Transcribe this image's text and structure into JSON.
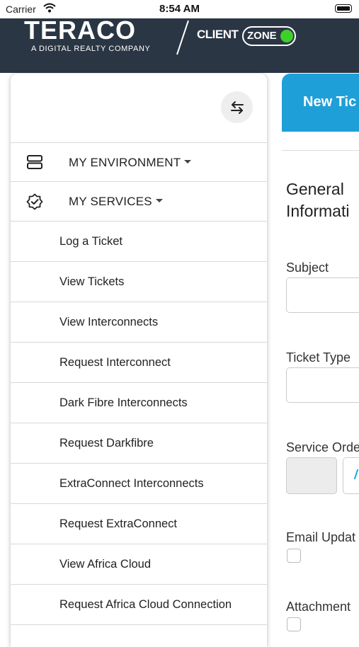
{
  "status_bar": {
    "carrier": "Carrier",
    "time": "8:54 AM"
  },
  "header": {
    "logo": "TERACO",
    "tagline": "A DIGITAL REALTY COMPANY",
    "client_label": "CLIENT",
    "zone_label": "ZONE"
  },
  "colors": {
    "header_bg": "#2b3644",
    "accent_blue": "#1f9fd8",
    "zone_green": "#3fcf2a"
  },
  "drawer": {
    "toggle_icon": "swap-arrows-icon",
    "sections": [
      {
        "label": "MY ENVIRONMENT",
        "icon": "server-icon"
      },
      {
        "label": "MY SERVICES",
        "icon": "badge-check-icon"
      }
    ],
    "items": [
      {
        "label": "Log a Ticket"
      },
      {
        "label": "View Tickets"
      },
      {
        "label": "View Interconnects"
      },
      {
        "label": "Request Interconnect"
      },
      {
        "label": "Dark Fibre Interconnects"
      },
      {
        "label": "Request Darkfibre"
      },
      {
        "label": "ExtraConnect Interconnects"
      },
      {
        "label": "Request ExtraConnect"
      },
      {
        "label": "View Africa Cloud"
      },
      {
        "label": "Request Africa Cloud Connection"
      }
    ]
  },
  "form": {
    "banner_title": "New Tic",
    "section_title_line1": "General",
    "section_title_line2": "Informati",
    "subject_label": "Subject",
    "ticket_type_label": "Ticket Type",
    "service_order_label": "Service Orde",
    "email_updates_label": "Email Updat",
    "attachment_label": "Attachment"
  }
}
